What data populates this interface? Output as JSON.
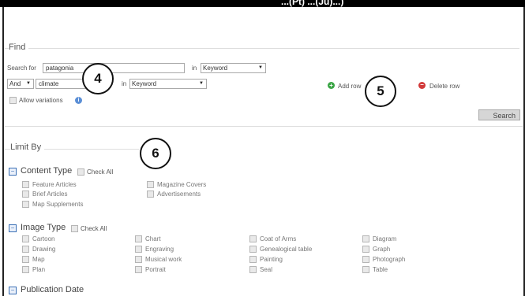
{
  "top_bar": {
    "text": "...(Pt) ...(Ju)...)"
  },
  "find": {
    "title": "Find",
    "row1": {
      "label": "Search for",
      "value": "patagonia",
      "in_label": "in",
      "field": "Keyword"
    },
    "row2": {
      "operator": "And",
      "value": "climate",
      "in_label": "in",
      "field": "Keyword"
    },
    "allow_variations": "Allow variations",
    "add_row": "Add row",
    "delete_row": "Delete row",
    "search_button": "Search"
  },
  "callouts": {
    "four": "4",
    "five": "5",
    "six": "6"
  },
  "limit_by": {
    "title": "Limit By",
    "content_type": {
      "title": "Content Type",
      "check_all": "Check All",
      "col1": [
        "Feature Articles",
        "Brief Articles",
        "Map Supplements"
      ],
      "col2": [
        "Magazine Covers",
        "Advertisements"
      ]
    },
    "image_type": {
      "title": "Image Type",
      "check_all": "Check All",
      "col1": [
        "Cartoon",
        "Drawing",
        "Map",
        "Plan"
      ],
      "col2": [
        "Chart",
        "Engraving",
        "Musical work",
        "Portrait"
      ],
      "col3": [
        "Coat of Arms",
        "Genealogical table",
        "Painting",
        "Seal"
      ],
      "col4": [
        "Diagram",
        "Graph",
        "Photograph",
        "Table"
      ]
    },
    "publication_date": {
      "title": "Publication Date"
    }
  }
}
